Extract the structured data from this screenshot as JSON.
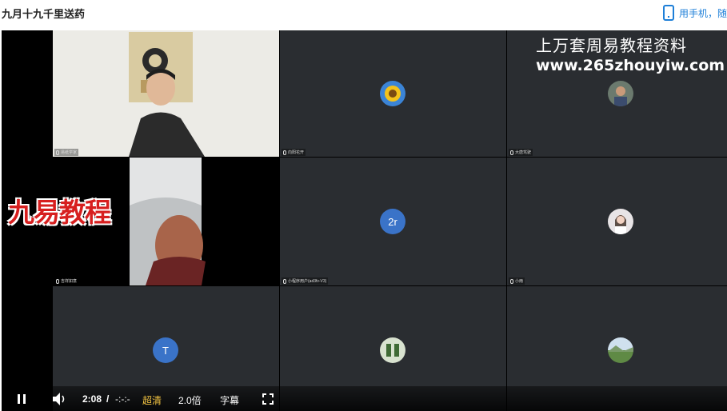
{
  "page": {
    "title": "九月十九千里送药",
    "mobile_label": "用手机，随"
  },
  "video": {
    "watermark_line1": "上万套周易教程资料",
    "watermark_line2": "www.265zhouyiw.com",
    "logo_text": "九易教程",
    "tiles": [
      {
        "id": "host",
        "name": "易纸学家"
      },
      {
        "id": "sunflower",
        "name": "向阳花开"
      },
      {
        "id": "person",
        "name": "大唐驾驶"
      },
      {
        "id": "elder",
        "name": "吉祥如意"
      },
      {
        "id": "2r",
        "name": "小程序用户(ad3fv-V3)",
        "avatar_letter": "2r"
      },
      {
        "id": "woman",
        "name": "小雨"
      },
      {
        "id": "t",
        "name": "",
        "avatar_letter": "T"
      },
      {
        "id": "green",
        "name": ""
      },
      {
        "id": "landscape",
        "name": ""
      }
    ]
  },
  "controls": {
    "play_pause_icon": "pause-icon",
    "volume_icon": "volume-icon",
    "current_time": "2:08",
    "separator": "/",
    "duration": "-:-:-",
    "quality": "超清",
    "speed": "2.0倍",
    "subtitles": "字幕",
    "fullscreen_icon": "fullscreen-icon",
    "quality_color": "#f5c542"
  }
}
